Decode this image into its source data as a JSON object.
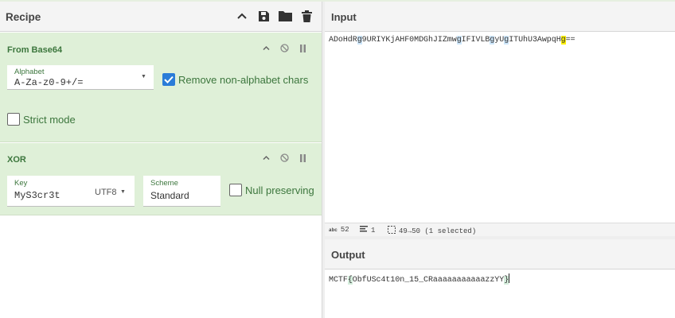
{
  "recipe": {
    "title": "Recipe",
    "header_icons": [
      "chevron-up-icon",
      "save-icon",
      "folder-icon",
      "trash-icon"
    ]
  },
  "operations": [
    {
      "title": "From Base64",
      "alphabet_label": "Alphabet",
      "alphabet_value": "A-Za-z0-9+/=",
      "remove_nonalpha_label": "Remove non-alphabet chars",
      "remove_nonalpha_checked": true,
      "strict_label": "Strict mode",
      "strict_checked": false
    },
    {
      "title": "XOR",
      "key_label": "Key",
      "key_value": "MyS3cr3t",
      "key_encoding": "UTF8",
      "scheme_label": "Scheme",
      "scheme_value": "Standard",
      "null_label": "Null preserving",
      "null_checked": false
    }
  ],
  "input": {
    "title": "Input",
    "segments": [
      {
        "t": "ADoHdR",
        "h": ""
      },
      {
        "t": "g",
        "h": "g"
      },
      {
        "t": "9URIYKjAHF0MDGhJIZmw",
        "h": ""
      },
      {
        "t": "g",
        "h": "g"
      },
      {
        "t": "IFIVLB",
        "h": ""
      },
      {
        "t": "g",
        "h": "g"
      },
      {
        "t": "yU",
        "h": ""
      },
      {
        "t": "g",
        "h": "g"
      },
      {
        "t": "ITUhU3AwpqH",
        "h": ""
      },
      {
        "t": "g",
        "h": "y"
      },
      {
        "t": "==",
        "h": ""
      }
    ]
  },
  "status": {
    "length": "52",
    "lines": "1",
    "selection": "49→50 (1 selected)"
  },
  "output": {
    "title": "Output",
    "segments": [
      {
        "t": "MCTF",
        "h": ""
      },
      {
        "t": "{",
        "h": "o"
      },
      {
        "t": "ObfUSc4t10n_15_CRaaaaaaaaaaazzYY",
        "h": ""
      },
      {
        "t": "}",
        "h": "o"
      }
    ]
  },
  "colors": {
    "op_bg": "#dff0d8",
    "op_text": "#3c763d",
    "checkbox_accent": "#2a7cd8",
    "highlight_blue": "#cfe8fc",
    "highlight_yellow": "#fff200"
  }
}
